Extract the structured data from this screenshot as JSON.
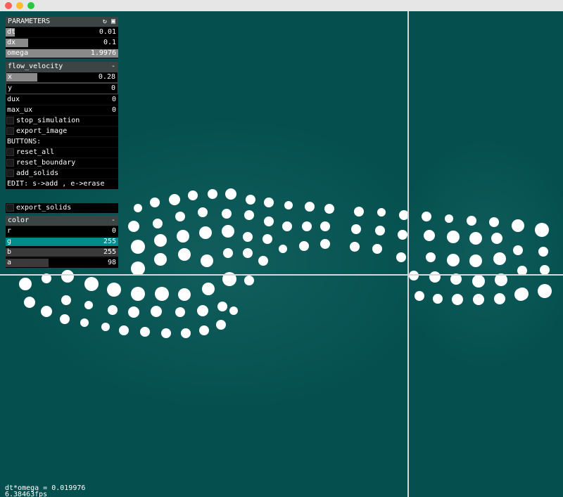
{
  "window": {
    "traffic_lights": [
      "#fc5f57",
      "#fdbc2e",
      "#28c840"
    ]
  },
  "colors": {
    "background": "#05504f",
    "solid": "#ffffff",
    "crosshair": "#d8d8d8"
  },
  "parameters": {
    "title": "PARAMETERS",
    "icons": [
      "refresh-icon",
      "save-icon"
    ],
    "sliders": [
      {
        "label": "dt",
        "value": "0.01",
        "fill": 0.08
      },
      {
        "label": "dx",
        "value": "0.1",
        "fill": 0.2
      },
      {
        "label": "omega",
        "value": "1.9976",
        "fill": 1.0
      }
    ]
  },
  "flow_velocity": {
    "title": "flow_velocity",
    "collapse": "-",
    "sliders": [
      {
        "label": "x",
        "value": "0.28",
        "fill": 0.28
      },
      {
        "label": "y",
        "value": "0",
        "fill": 0
      }
    ],
    "readouts": [
      {
        "label": "dux",
        "value": "0"
      },
      {
        "label": "max_ux",
        "value": "0"
      }
    ],
    "checkboxes": [
      {
        "label": "stop_simulation"
      },
      {
        "label": "export_image"
      }
    ],
    "buttons_label": "BUTTONS:",
    "buttons": [
      {
        "label": "reset_all"
      },
      {
        "label": "reset_boundary"
      },
      {
        "label": "add_solids"
      }
    ],
    "edit_hint": "EDIT: s->add , e->erase",
    "export_solids": "export_solids"
  },
  "color": {
    "title": "color",
    "collapse": "-",
    "sliders": [
      {
        "label": "r",
        "value": "0",
        "fill": 0
      },
      {
        "label": "g",
        "value": "255",
        "fill": 1.0,
        "color": "#008b8b"
      },
      {
        "label": "b",
        "value": "255",
        "fill": 1.0,
        "color": "#3a3a3a"
      },
      {
        "label": "a",
        "value": "98",
        "fill": 0.38,
        "color": "#3a3a3a"
      }
    ]
  },
  "status": {
    "dt_omega": "dt*omega = 0.019976",
    "fps": "6.38463fps"
  }
}
